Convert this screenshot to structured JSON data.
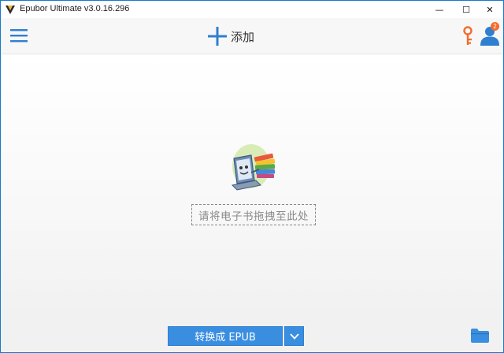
{
  "window": {
    "title": "Epubor Ultimate v3.0.16.296",
    "controls": {
      "minimize": "—",
      "maximize": "☐",
      "close": "✕"
    }
  },
  "toolbar": {
    "menu_icon": "hamburger-menu-icon",
    "add_label": "添加",
    "add_icon": "plus-icon",
    "key_icon": "key-icon",
    "user_icon": "user-icon",
    "user_badge": "2"
  },
  "main": {
    "illustration": "laptop-with-books-icon",
    "drop_text": "请将电子书拖拽至此处"
  },
  "bottom": {
    "convert_label": "转换成 EPUB",
    "dropdown_icon": "chevron-down-icon",
    "folder_icon": "folder-icon"
  },
  "colors": {
    "accent": "#3a8ee0",
    "toolbar_icon": "#2f7fd0",
    "key_orange": "#f26c2a",
    "border": "#1979ca"
  }
}
